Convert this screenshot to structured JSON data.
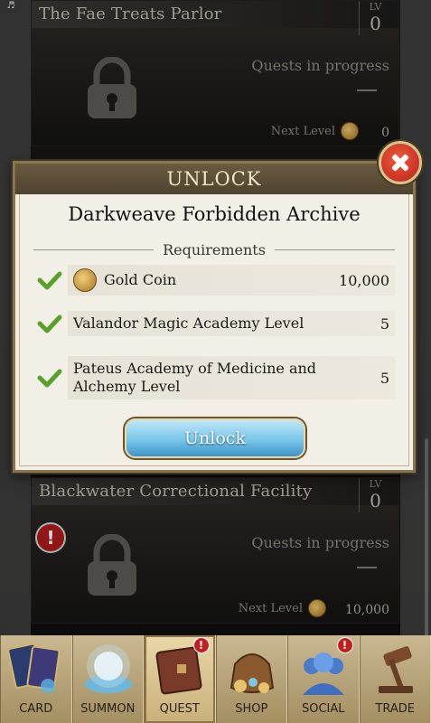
{
  "top": {
    "music_icon": "♬"
  },
  "locations": [
    {
      "title": "The Fae Treats Parlor",
      "lv_label": "LV",
      "lv_value": "0",
      "progress": "Quests in progress",
      "progress_value": "—",
      "next_level_label": "Next Level",
      "next_level_value": "0"
    },
    {
      "title": "Blackwater Correctional Facility",
      "lv_label": "LV",
      "lv_value": "0",
      "progress": "Quests in progress",
      "progress_value": "—",
      "next_level_label": "Next Level",
      "next_level_value": "10,000",
      "alert": "!"
    }
  ],
  "dialog": {
    "header": "UNLOCK",
    "target": "Darkweave Forbidden Archive",
    "requirements_label": "Requirements",
    "requirements": [
      {
        "name": "Gold Coin",
        "value": "10,000",
        "icon": "gold-coin-icon",
        "met": true
      },
      {
        "name": "Valandor Magic Academy Level",
        "value": "5",
        "met": true
      },
      {
        "name": "Pateus Academy of Medicine and Alchemy Level",
        "value": "5",
        "met": true
      }
    ],
    "unlock_button": "Unlock"
  },
  "nav": {
    "items": [
      {
        "label": "CARD",
        "icon": "card-icon"
      },
      {
        "label": "SUMMON",
        "icon": "summon-icon"
      },
      {
        "label": "QUEST",
        "icon": "quest-book-icon",
        "active": true,
        "badge": "!"
      },
      {
        "label": "SHOP",
        "icon": "shop-bag-icon"
      },
      {
        "label": "SOCIAL",
        "icon": "social-icon",
        "badge": "!"
      },
      {
        "label": "TRADE",
        "icon": "gavel-icon"
      }
    ]
  },
  "colors": {
    "accent_gold": "#8a7550",
    "button_blue": "#78c6ea",
    "close_red": "#d23a26",
    "check_green": "#5aa02c"
  }
}
